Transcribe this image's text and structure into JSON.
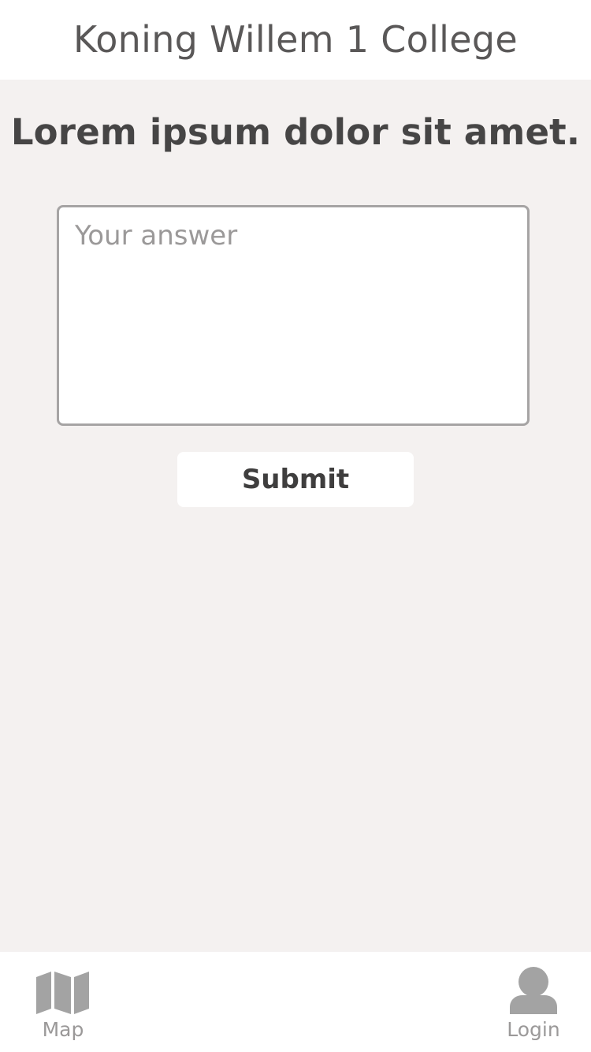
{
  "header": {
    "title": "Koning Willem 1 College"
  },
  "question": {
    "text": "Lorem ipsum dolor sit amet."
  },
  "answer": {
    "placeholder": "Your answer",
    "value": ""
  },
  "submit": {
    "label": "Submit"
  },
  "tabbar": {
    "items": [
      {
        "label": "Map",
        "icon": "map-icon"
      },
      {
        "label": "Login",
        "icon": "user-icon"
      }
    ]
  },
  "colors": {
    "background": "#f4f1f0",
    "surface": "#ffffff",
    "text_dark": "#464545",
    "text_muted": "#9b9999",
    "border": "#a6a4a4",
    "icon": "#a3a3a3"
  }
}
